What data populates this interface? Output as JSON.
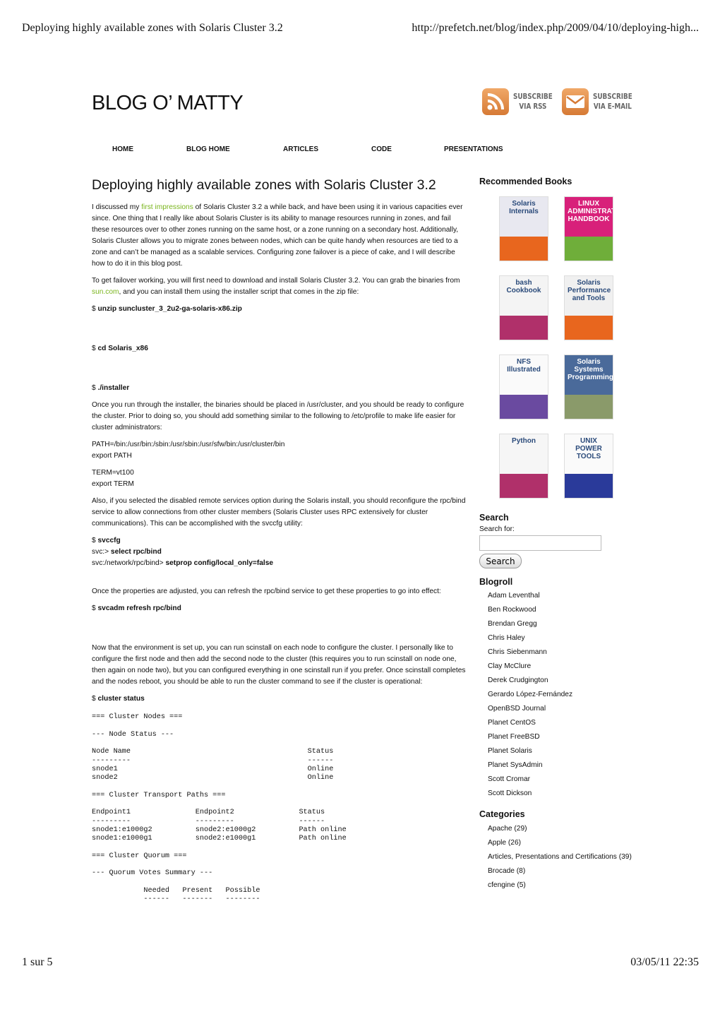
{
  "print_header": {
    "title": "Deploying highly available zones with Solaris Cluster 3.2",
    "url": "http://prefetch.net/blog/index.php/2009/04/10/deploying-high..."
  },
  "print_footer": {
    "page": "1 sur 5",
    "datetime": "03/05/11 22:35"
  },
  "blog_title": "BLOG O’ MATTY",
  "subscribe": [
    {
      "icon": "rss-icon",
      "line1": "SUBSCRIBE",
      "line2": "VIA RSS"
    },
    {
      "icon": "mail-icon",
      "line1": "SUBSCRIBE",
      "line2": "VIA E-MAIL"
    }
  ],
  "nav": [
    "HOME",
    "BLOG HOME",
    "ARTICLES",
    "CODE",
    "PRESENTATIONS"
  ],
  "post": {
    "title": "Deploying highly available zones with Solaris Cluster 3.2",
    "p1_a": "I discussed my ",
    "p1_link": "first impressions",
    "p1_b": " of Solaris Cluster 3.2 a while back, and have been using it in various capacities ever since. One thing that I really like about Solaris Cluster is its ability to manage resources running in zones, and fail these resources over to other zones running on the same host, or a zone running on a secondary host. Additionally, Solaris Cluster allows you to migrate zones between nodes, which can be quite handy when resources are tied to a zone and can’t be managed as a scalable services. Configuring zone failover is a piece of cake, and I will describe how to do it in this blog post.",
    "p2_a": "To get failover working, you will first need to download and install Solaris Cluster 3.2. You can grab the binaries from ",
    "p2_link": "sun.com",
    "p2_b": ", and you can install them using the installer script that comes in the zip file:",
    "prompt": "$ ",
    "cmd1": "unzip suncluster_3_2u2-ga-solaris-x86.zip",
    "cmd2": "cd Solaris_x86",
    "cmd3": "./installer",
    "p3": "Once you run through the installer, the binaries should be placed in /usr/cluster, and you should be ready to configure the cluster. Prior to doing so, you should add something similar to the following to /etc/profile to make life easier for cluster administrators:",
    "path1": "PATH=/bin:/usr/bin:/sbin:/usr/sbin:/usr/sfw/bin:/usr/cluster/bin",
    "path2": "export PATH",
    "term1": "TERM=vt100",
    "term2": "export TERM",
    "p4": "Also, if you selected the disabled remote services option during the Solaris install, you should reconfigure the rpc/bind service to allow connections from other cluster members (Solaris Cluster uses RPC extensively for cluster communications). This can be accomplished with the svccfg utility:",
    "svc1": "svccfg",
    "svc2_prompt": "svc:> ",
    "svc2": "select rpc/bind",
    "svc3_prompt": "svc:/network/rpc/bind> ",
    "svc3": "setprop config/local_only=false",
    "p5": "Once the properties are adjusted, you can refresh the rpc/bind service to get these properties to go into effect:",
    "cmd4": "svcadm refresh rpc/bind",
    "p6": "Now that the environment is set up, you can run scinstall on each node to configure the cluster. I personally like to configure the first node and then add the second node to the cluster (this requires you to run scinstall on node one, then again on node two), but you can configured everything in one scinstall run if you prefer. Once scinstall completes and the nodes reboot, you should be able to run the cluster command to see if the cluster is operational:",
    "cmd5": "cluster status",
    "out1": "=== Cluster Nodes ===",
    "out2": "--- Node Status ---",
    "out3": "Node Name                                         Status\n---------                                         ------\nsnode1                                            Online\nsnode2                                            Online",
    "out4": "=== Cluster Transport Paths ===",
    "out5": "Endpoint1               Endpoint2               Status\n---------               ---------               ------\nsnode1:e1000g2          snode2:e1000g2          Path online\nsnode1:e1000g1          snode2:e1000g1          Path online",
    "out6": "=== Cluster Quorum ===",
    "out7": "--- Quorum Votes Summary ---",
    "out8": "            Needed   Present   Possible\n            ------   -------   --------"
  },
  "sidebar": {
    "books_title": "Recommended Books",
    "books": [
      {
        "title": "Solaris Internals",
        "color": "#e8e8f0",
        "accent": "#e8661e"
      },
      {
        "title": "LINUX ADMINISTRATION HANDBOOK",
        "color": "#d8207a",
        "accent": "#6fae3a"
      },
      {
        "title": "bash Cookbook",
        "color": "#f4f4f4",
        "accent": "#b0306a"
      },
      {
        "title": "Solaris Performance and Tools",
        "color": "#f0f0f0",
        "accent": "#e8661e"
      },
      {
        "title": "NFS Illustrated",
        "color": "#fafafa",
        "accent": "#6a4aa0"
      },
      {
        "title": "Solaris Systems Programming",
        "color": "#4a6a9a",
        "accent": "#8a9a6a"
      },
      {
        "title": "Python",
        "color": "#f6f6f6",
        "accent": "#b0306a"
      },
      {
        "title": "UNIX POWER TOOLS",
        "color": "#fafafa",
        "accent": "#2a3a9a"
      }
    ],
    "search_title": "Search",
    "search_label": "Search for:",
    "search_value": "",
    "search_button": "Search",
    "blogroll_title": "Blogroll",
    "blogroll": [
      "Adam Leventhal",
      "Ben Rockwood",
      "Brendan Gregg",
      "Chris Haley",
      "Chris Siebenmann",
      "Clay McClure",
      "Derek Crudgington",
      "Gerardo López-Fernández",
      "OpenBSD Journal",
      "Planet CentOS",
      "Planet FreeBSD",
      "Planet Solaris",
      "Planet SysAdmin",
      "Scott Cromar",
      "Scott Dickson"
    ],
    "categories_title": "Categories",
    "categories": [
      "Apache (29)",
      "Apple (26)",
      "Articles, Presentations and Certifications (39)",
      "Brocade (8)",
      "cfengine (5)"
    ]
  },
  "colors": {
    "link": "#7ab51d",
    "subscribe_orange": "#e08a45"
  }
}
